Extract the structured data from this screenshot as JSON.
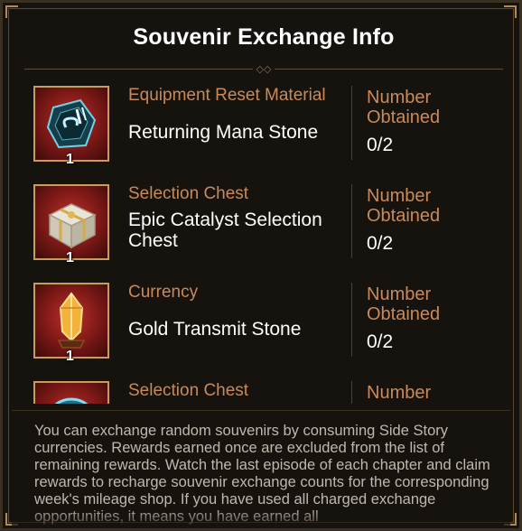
{
  "title": "Souvenir Exchange Info",
  "items": [
    {
      "category": "Equipment Reset Material",
      "name": "Returning Mana Stone",
      "label": "Number Obtained",
      "count": "0/2",
      "qty": "1",
      "icon": "mana-stone-icon"
    },
    {
      "category": "Selection Chest",
      "name": "Epic Catalyst Selection Chest",
      "label": "Number Obtained",
      "count": "0/2",
      "qty": "1",
      "icon": "chest-icon"
    },
    {
      "category": "Currency",
      "name": "Gold Transmit Stone",
      "label": "Number Obtained",
      "count": "0/2",
      "qty": "1",
      "icon": "gold-stone-icon"
    },
    {
      "category": "Selection Chest",
      "name": "",
      "label": "Number",
      "count": "",
      "qty": "",
      "icon": "selection-chest-icon"
    }
  ],
  "description": "You can exchange random souvenirs by consuming Side Story currencies. Rewards earned once are excluded from the list of remaining rewards. Watch the last episode of each chapter and claim rewards to recharge souvenir exchange counts for the corresponding week's mileage shop. If you have used all charged exchange opportunities, it means you have earned all",
  "colors": {
    "accent": "#c98a57",
    "frame": "#c79d5e",
    "background": "#16130f"
  }
}
